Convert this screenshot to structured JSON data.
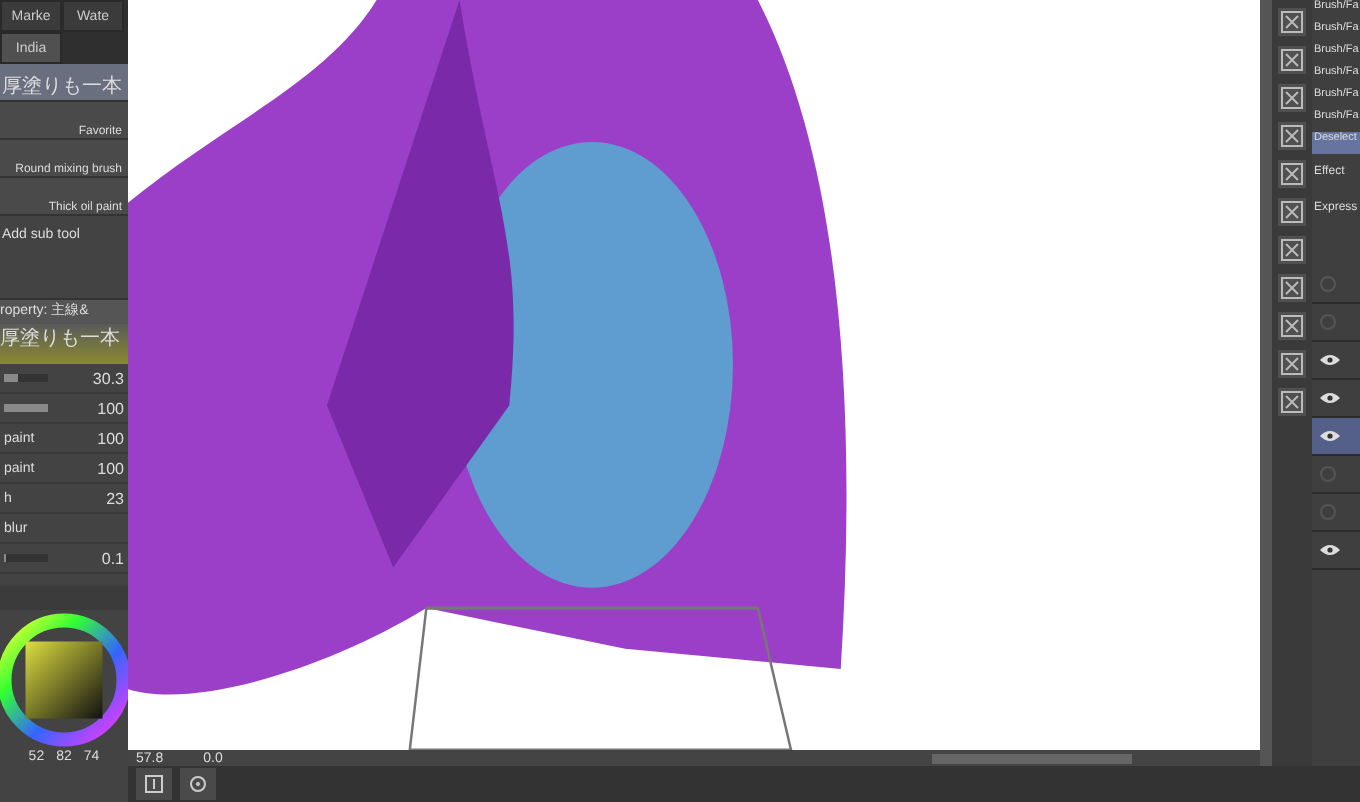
{
  "tool_tabs": [
    {
      "label": "Marke",
      "selected": false
    },
    {
      "label": "Wate",
      "selected": false
    },
    {
      "label": "India",
      "selected": true
    }
  ],
  "brushes": [
    {
      "label": "厚塗りも一本",
      "selected": true
    },
    {
      "label": "Favorite",
      "selected": false
    },
    {
      "label": "Round mixing brush",
      "selected": false
    },
    {
      "label": "Thick oil paint",
      "selected": false
    }
  ],
  "add_sub_tool": "Add sub tool",
  "property": {
    "title": "roperty: 主線&",
    "brush_name": "厚塗りも一本",
    "params": [
      {
        "value": "30.3",
        "level": 0.3
      },
      {
        "value": "100",
        "level": 1
      },
      {
        "label": "paint",
        "value": "100"
      },
      {
        "label": "paint",
        "value": "100"
      },
      {
        "label": "h",
        "value": "23"
      },
      {
        "label": "blur"
      },
      {
        "value": "0.1",
        "level": 0.05
      }
    ]
  },
  "color_readout": [
    "52",
    "82",
    "74"
  ],
  "right_list": [
    {
      "label": "Brush/Fa",
      "selected": false
    },
    {
      "label": "Brush/Fa",
      "selected": false
    },
    {
      "label": "Brush/Fa",
      "selected": false
    },
    {
      "label": "Brush/Fa",
      "selected": false
    },
    {
      "label": "Brush/Fa",
      "selected": false
    },
    {
      "label": "Brush/Fa",
      "selected": false
    },
    {
      "label": "Deselect",
      "selected": true
    }
  ],
  "right_labels": [
    "Effect",
    "Express"
  ],
  "layers": [
    {
      "visible": false
    },
    {
      "visible": false
    },
    {
      "visible": true
    },
    {
      "visible": true
    },
    {
      "visible": true,
      "selected": true
    },
    {
      "visible": false
    },
    {
      "visible": false
    },
    {
      "visible": true
    }
  ],
  "status": {
    "zoom": "57.8",
    "angle": "0.0"
  }
}
